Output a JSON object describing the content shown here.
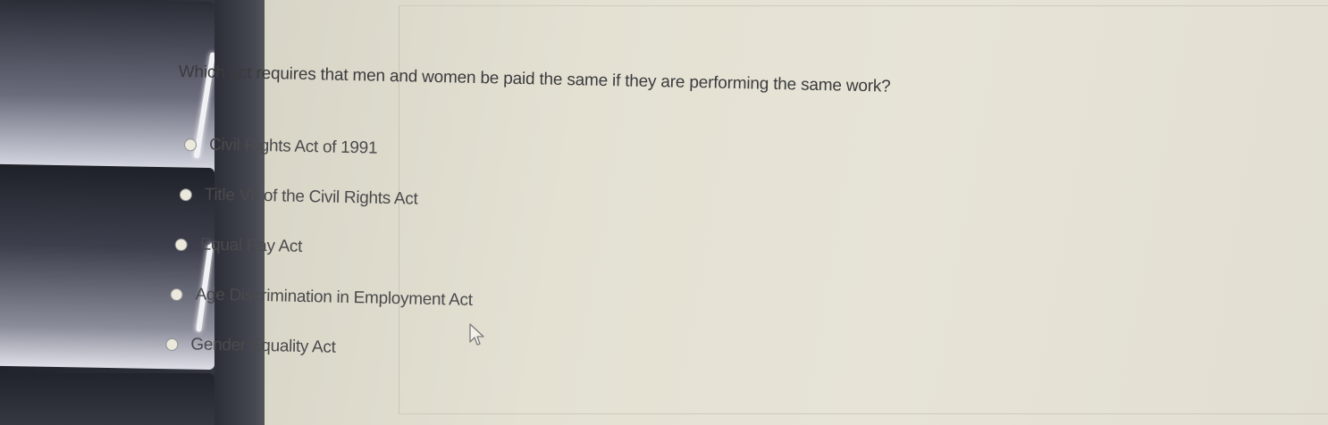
{
  "quiz": {
    "question": "Which act requires that men and women be paid the same if they are performing the same work?",
    "options": [
      {
        "label": "Civil Rights Act of 1991"
      },
      {
        "label": "Title VII of the Civil Rights Act"
      },
      {
        "label": "Equal Pay Act"
      },
      {
        "label": "Age Discrimination in Employment Act"
      },
      {
        "label": "Gender Equality Act"
      }
    ]
  },
  "icons": {
    "cursor": "mouse-pointer-icon",
    "option_control": "radio-button-icon"
  },
  "colors": {
    "screen_background": "#e4e1d3",
    "text": "#3b3b3d",
    "radio_border": "#8f8f92"
  }
}
